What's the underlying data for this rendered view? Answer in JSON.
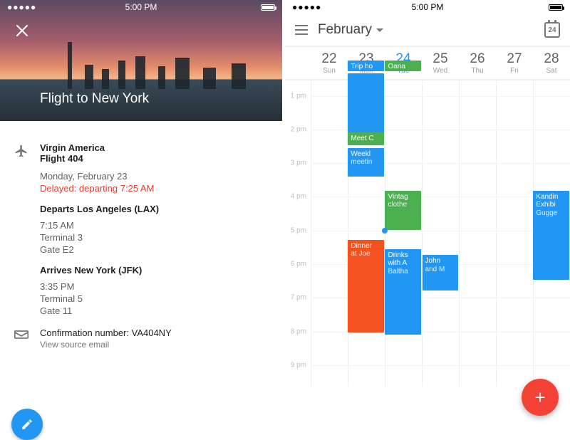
{
  "status": {
    "time": "5:00 PM",
    "signal": "●●●●●"
  },
  "flight": {
    "title": "Flight to New York",
    "airline": "Virgin America",
    "flight_no": "Flight 404",
    "date": "Monday, February 23",
    "delay": "Delayed: departing 7:25 AM",
    "dep_head": "Departs Los Angeles (LAX)",
    "dep_time": "7:15 AM",
    "dep_terminal": "Terminal 3",
    "dep_gate": "Gate E2",
    "arr_head": "Arrives New York (JFK)",
    "arr_time": "3:35 PM",
    "arr_terminal": "Terminal 5",
    "arr_gate": "Gate 11",
    "confirmation": "Confirmation number: VA404NY",
    "source_link": "View source email"
  },
  "calendar": {
    "month": "February",
    "today_badge": "24",
    "days": [
      {
        "num": "22",
        "name": "Sun"
      },
      {
        "num": "23",
        "name": "Mon"
      },
      {
        "num": "24",
        "name": "Tue"
      },
      {
        "num": "25",
        "name": "Wed"
      },
      {
        "num": "26",
        "name": "Thu"
      },
      {
        "num": "27",
        "name": "Fri"
      },
      {
        "num": "28",
        "name": "Sat"
      }
    ],
    "hours": [
      "1 pm",
      "2 pm",
      "3 pm",
      "4 pm",
      "5 pm",
      "6 pm",
      "7 pm",
      "8 pm",
      "9 pm"
    ],
    "events": {
      "trip": {
        "t1": "Trip ho"
      },
      "oana": {
        "t1": "Oana"
      },
      "meet": {
        "t1": "Meet C"
      },
      "weekl": {
        "t1": "Weekl",
        "t2": "meetin"
      },
      "vintage": {
        "t1": "Vintag",
        "t2": "clothe"
      },
      "dinner": {
        "t1": "Dinner",
        "t2": "at Joe"
      },
      "drinks": {
        "t1": "Drinks",
        "t2": "with A",
        "t3": "Baltha"
      },
      "john": {
        "t1": "John",
        "t2": "and M"
      },
      "kandin": {
        "t1": "Kandin",
        "t2": "Exhibi",
        "t3": "Gugge"
      }
    }
  }
}
